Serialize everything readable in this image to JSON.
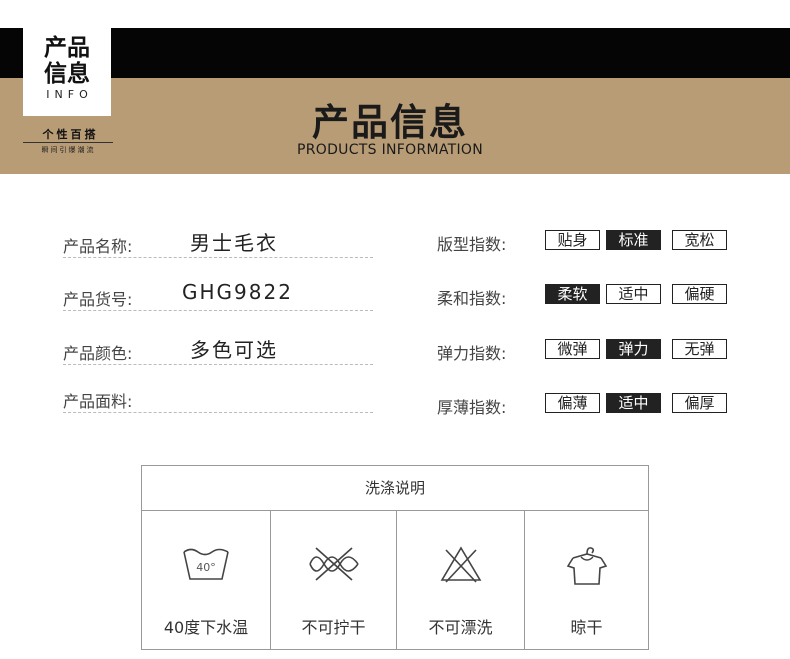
{
  "badge": {
    "line1": "产品",
    "line2": "信息",
    "sub": "INFO"
  },
  "tagline": {
    "main": "个性百搭",
    "sub": "瞬间引爆潮流"
  },
  "header": {
    "title": "产品信息",
    "subtitle": "PRODUCTS INFORMATION"
  },
  "info": [
    {
      "label": "产品名称:",
      "value": "男士毛衣"
    },
    {
      "label": "产品货号:",
      "value": "GHG9822"
    },
    {
      "label": "产品颜色:",
      "value": "多色可选"
    },
    {
      "label": "产品面料:",
      "value": ""
    }
  ],
  "indices": [
    {
      "label": "版型指数:",
      "options": [
        "贴身",
        "标准",
        "宽松"
      ],
      "selected": "标准"
    },
    {
      "label": "柔和指数:",
      "options": [
        "柔软",
        "适中",
        "偏硬"
      ],
      "selected": "柔软"
    },
    {
      "label": "弹力指数:",
      "options": [
        "微弹",
        "弹力",
        "无弹"
      ],
      "selected": "弹力"
    },
    {
      "label": "厚薄指数:",
      "options": [
        "偏薄",
        "适中",
        "偏厚"
      ],
      "selected": "适中"
    }
  ],
  "care": {
    "title": "洗涤说明",
    "items": [
      {
        "icon": "wash-40-icon",
        "icon_text": "40°",
        "label": "40度下水温"
      },
      {
        "icon": "do-not-wring-icon",
        "label": "不可拧干"
      },
      {
        "icon": "do-not-bleach-icon",
        "label": "不可漂洗"
      },
      {
        "icon": "hang-dry-icon",
        "label": "晾干"
      }
    ]
  }
}
